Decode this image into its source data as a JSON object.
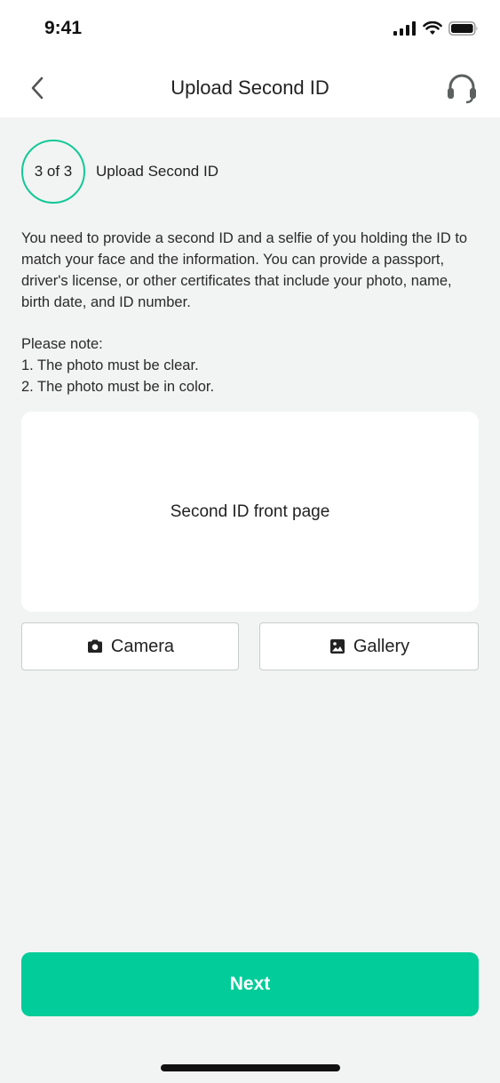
{
  "status": {
    "time": "9:41"
  },
  "header": {
    "title": "Upload Second ID"
  },
  "step": {
    "indicator": "3 of 3",
    "label": "Upload Second ID"
  },
  "instructions": {
    "text": "You need to provide a second ID and a selfie of you holding the ID to match your face and the information. You can provide a passport, driver's license, or other certificates that include your photo, name, birth date, and ID number.",
    "note_heading": "Please note:",
    "notes": [
      "1. The photo must be clear.",
      "2. The photo must be in color."
    ]
  },
  "upload": {
    "label": "Second ID front page"
  },
  "sources": {
    "camera_label": "Camera",
    "gallery_label": "Gallery"
  },
  "footer": {
    "next_label": "Next"
  },
  "icons": {
    "back": "chevron-left-icon",
    "support": "headset-icon",
    "camera": "camera-icon",
    "gallery": "image-icon",
    "signal": "signal-icon",
    "wifi": "wifi-icon",
    "battery": "battery-icon"
  },
  "colors": {
    "accent": "#02cc99",
    "step_ring": "#13c896",
    "background": "#f2f4f3"
  }
}
